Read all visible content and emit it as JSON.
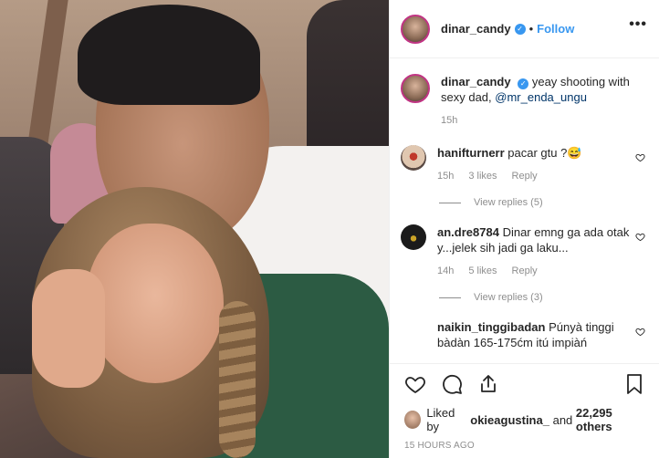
{
  "post": {
    "username": "dinar_candy",
    "verified_mark": "✓",
    "follow_label": "Follow",
    "more_label": "•••",
    "separator": "•"
  },
  "caption": {
    "username": "dinar_candy",
    "text": "yeay shooting with sexy dad,",
    "mention": "@mr_enda_ungu",
    "time": "15h"
  },
  "comments": [
    {
      "username": "hanifturnerr",
      "text": "pacar gtu ?😅",
      "time": "15h",
      "likes": "3 likes",
      "reply_label": "Reply",
      "view_replies": "View replies (5)"
    },
    {
      "username": "an.dre8784",
      "text": "Dinar emng ga ada otak y...jelek sih jadi ga laku...",
      "time": "14h",
      "likes": "5 likes",
      "reply_label": "Reply",
      "view_replies": "View replies (3)"
    },
    {
      "username": "naikin_tinggibadan",
      "text": "Púnyà tinggi bàdàn 165-175ćm itú impiàń"
    }
  ],
  "likes": {
    "prefix": "Liked by",
    "user": "okieagustina_",
    "conjunction": "and",
    "others": "22,295 others"
  },
  "timestamp": "15 HOURS AGO",
  "icons": [
    "heart-icon",
    "comment-icon",
    "share-icon",
    "bookmark-icon",
    "more-icon",
    "verified-icon"
  ],
  "colors": {
    "link_blue": "#3897f0",
    "verified_blue": "#3897f0",
    "muted_gray": "#8e8e8e",
    "mention_blue": "#003569"
  }
}
